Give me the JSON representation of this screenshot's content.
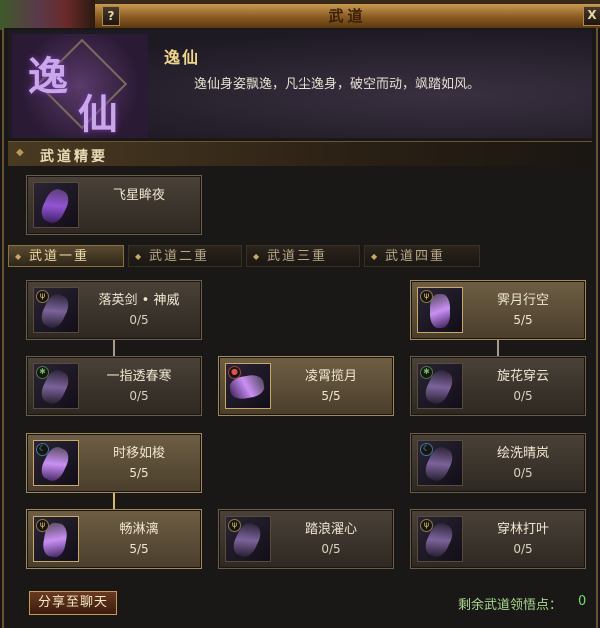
{
  "window": {
    "title": "武道",
    "help_label": "?",
    "close_label": "X"
  },
  "sect": {
    "emblem_chars": [
      "逸",
      "仙"
    ],
    "name": "逸仙",
    "description": "逸仙身姿飘逸，凡尘逸身，破空而动，飒踏如风。"
  },
  "essentials": {
    "title": "武道精要",
    "skill": {
      "name": "飞星眸夜"
    }
  },
  "tabs": [
    {
      "label": "武道一重",
      "selected": true
    },
    {
      "label": "武道二重",
      "selected": false
    },
    {
      "label": "武道三重",
      "selected": false
    },
    {
      "label": "武道四重",
      "selected": false
    }
  ],
  "skills": [
    {
      "name": "落英剑 • 神威",
      "progress": "0/5",
      "active": false
    },
    {
      "name": "霁月行空",
      "progress": "5/5",
      "active": true
    },
    {
      "name": "一指透春寒",
      "progress": "0/5",
      "active": false
    },
    {
      "name": "凌霄揽月",
      "progress": "5/5",
      "active": true
    },
    {
      "name": "旋花穿云",
      "progress": "0/5",
      "active": false
    },
    {
      "name": "时移如梭",
      "progress": "5/5",
      "active": true
    },
    {
      "name": "绘洗晴岚",
      "progress": "0/5",
      "active": false
    },
    {
      "name": "畅淋漓",
      "progress": "5/5",
      "active": true
    },
    {
      "name": "踏浪濯心",
      "progress": "0/5",
      "active": false
    },
    {
      "name": "穿林打叶",
      "progress": "0/5",
      "active": false
    }
  ],
  "footer": {
    "share_label": "分享至聊天",
    "points_label": "剩余武道领悟点：",
    "points_value": "0"
  },
  "colors": {
    "accent_gold": "#f0d68a",
    "points_green": "#6ae06a",
    "active_card": "#6e5e44"
  }
}
